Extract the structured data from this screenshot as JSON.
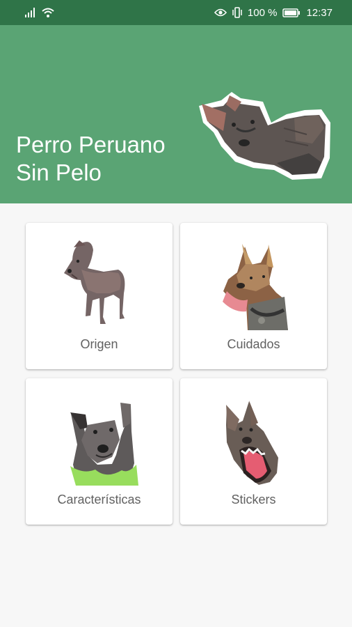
{
  "status_bar": {
    "battery_text": "100 %",
    "time": "12:37",
    "icons": [
      "signal-icon",
      "wifi-icon",
      "eye-icon",
      "vibrate-icon",
      "battery-icon"
    ]
  },
  "header": {
    "title": "Perro Peruano Sin Pelo",
    "background_color": "#5aa474",
    "status_bar_color": "#2f7448"
  },
  "menu": {
    "items": [
      {
        "label": "Origen",
        "image": "standing-dog-image"
      },
      {
        "label": "Cuidados",
        "image": "dog-tongue-out-image"
      },
      {
        "label": "Características",
        "image": "dog-green-bandana-image"
      },
      {
        "label": "Stickers",
        "image": "dog-open-mouth-image"
      }
    ]
  }
}
